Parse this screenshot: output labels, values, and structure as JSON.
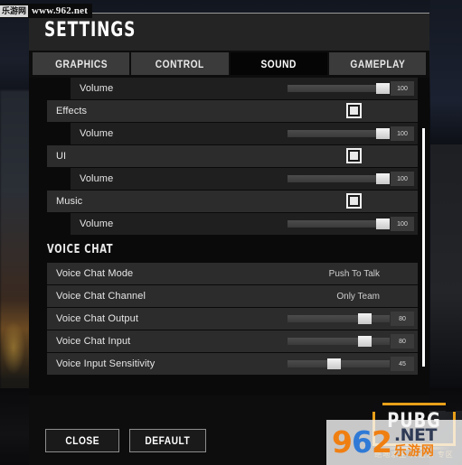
{
  "watermarks": {
    "top_left_cn": "乐游网",
    "top_left_url": "www.962.net",
    "logo_word": "PUBG",
    "logo_sub": "绝地求生 大逃杀 专区",
    "brand_962": "962",
    "brand_net": ".NET",
    "brand_cn": "乐游网"
  },
  "panel": {
    "title": "SETTINGS",
    "tabs": [
      {
        "label": "GRAPHICS",
        "active": false
      },
      {
        "label": "CONTROL",
        "active": false
      },
      {
        "label": "SOUND",
        "active": true
      },
      {
        "label": "GAMEPLAY",
        "active": false
      }
    ],
    "rows": [
      {
        "type": "slider",
        "indent": "child",
        "label": "Volume",
        "value": 100
      },
      {
        "type": "checkbox",
        "indent": "parent",
        "label": "Effects",
        "checked": true
      },
      {
        "type": "slider",
        "indent": "child",
        "label": "Volume",
        "value": 100
      },
      {
        "type": "checkbox",
        "indent": "parent",
        "label": "UI",
        "checked": true
      },
      {
        "type": "slider",
        "indent": "child",
        "label": "Volume",
        "value": 100
      },
      {
        "type": "checkbox",
        "indent": "parent",
        "label": "Music",
        "checked": true
      },
      {
        "type": "slider",
        "indent": "child",
        "label": "Volume",
        "value": 100
      },
      {
        "type": "header",
        "label": "VOICE CHAT"
      },
      {
        "type": "option",
        "indent": "parent",
        "label": "Voice Chat Mode",
        "value": "Push To Talk"
      },
      {
        "type": "option",
        "indent": "parent",
        "label": "Voice Chat Channel",
        "value": "Only Team"
      },
      {
        "type": "slider",
        "indent": "parent",
        "label": "Voice Chat Output",
        "value": 80
      },
      {
        "type": "slider",
        "indent": "parent",
        "label": "Voice Chat Input",
        "value": 80
      },
      {
        "type": "slider",
        "indent": "parent",
        "label": "Voice Input Sensitivity",
        "value": 45
      }
    ],
    "buttons": [
      {
        "label": "CLOSE"
      },
      {
        "label": "DEFAULT"
      }
    ]
  },
  "colors": {
    "accent_orange": "#e8a019",
    "panel_bg": "#0d0d0d",
    "row_bg": "#2c2c2c",
    "tab_active": "#050505"
  }
}
